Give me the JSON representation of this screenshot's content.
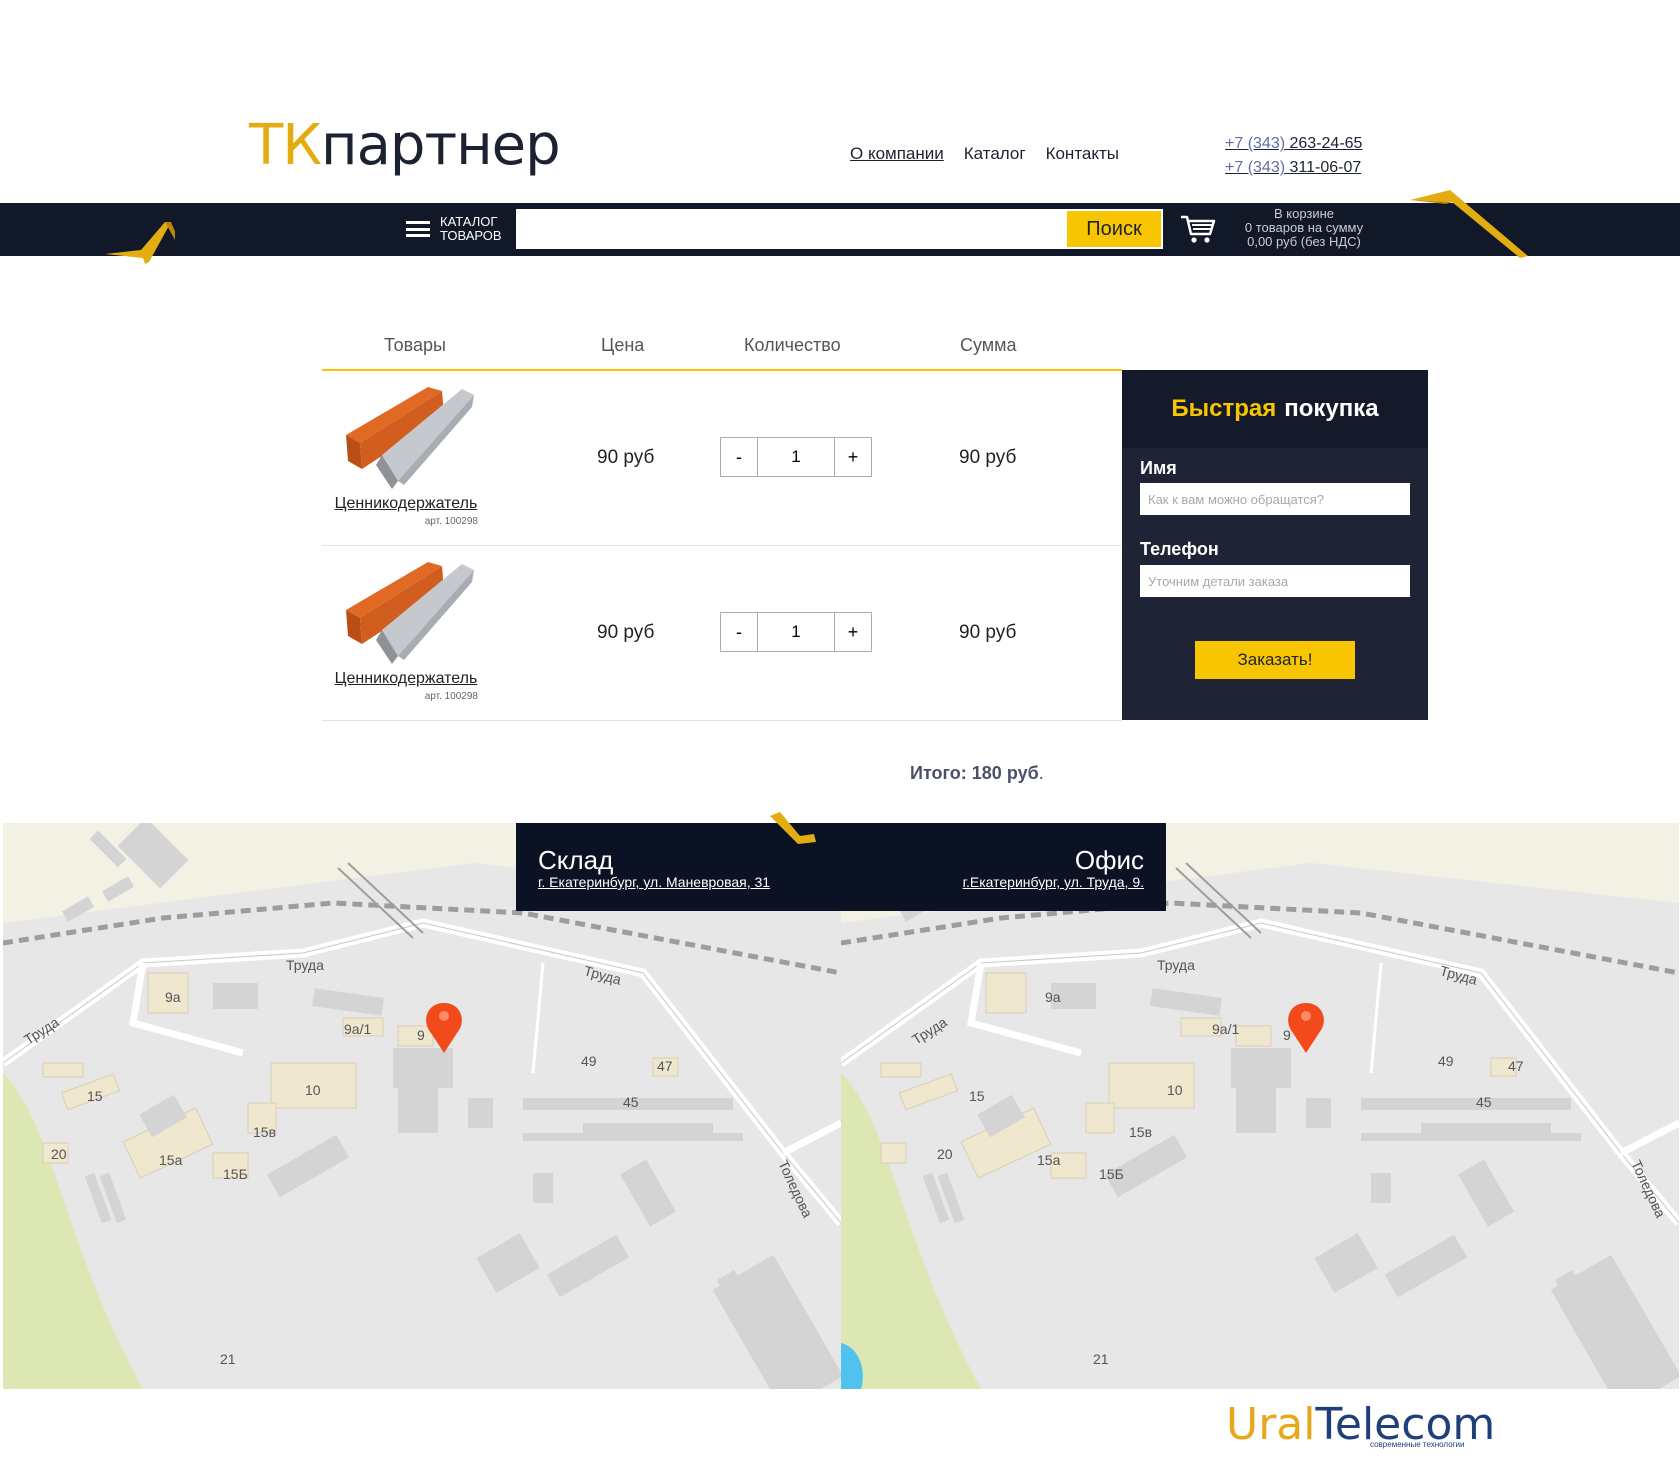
{
  "brand": {
    "logo_tk": "ТК",
    "logo_rest": "партнер"
  },
  "nav": [
    {
      "label": "О компании"
    },
    {
      "label": "Каталог"
    },
    {
      "label": "Контакты"
    }
  ],
  "phones": [
    {
      "code": "+7 (343)",
      "number": "263-24-65"
    },
    {
      "code": "+7 (343)",
      "number": "311-06-07"
    }
  ],
  "catalog_button": {
    "line1": "КАТАЛОГ",
    "line2": "ТОВАРОВ"
  },
  "search": {
    "value": "",
    "button_label": "Поиск"
  },
  "cart_summary": {
    "line1": "В корзине",
    "line2": "0 товаров на сумму",
    "line3": "0,00 руб (без НДС)"
  },
  "table": {
    "headers": {
      "products": "Товары",
      "price": "Цена",
      "quantity": "Количество",
      "sum": "Сумма"
    },
    "rows": [
      {
        "name": "Ценникодержатель",
        "article": "арт. 100298",
        "price": "90 руб",
        "qty": "1",
        "sum": "90 руб"
      },
      {
        "name": "Ценникодержатель",
        "article": "арт. 100298",
        "price": "90 руб",
        "qty": "1",
        "sum": "90 руб"
      }
    ],
    "minus_label": "-",
    "plus_label": "+"
  },
  "quick_buy": {
    "title_accent": "Быстрая",
    "title_rest": "покупка",
    "name_label": "Имя",
    "name_placeholder": "Как к вам можно обращатся?",
    "phone_label": "Телефон",
    "phone_placeholder": "Уточним детали заказа",
    "submit_label": "Заказать!"
  },
  "total": {
    "label": "Итого:",
    "value": "180 руб",
    "suffix": "."
  },
  "locations": [
    {
      "title": "Склад",
      "address": "г. Екатеринбург, ул. Маневровая, 31"
    },
    {
      "title": "Офис",
      "address": "г.Екатеринбург, ул. Труда, 9."
    }
  ],
  "map_labels": {
    "streets": [
      "Труда",
      "Труда",
      "Труда",
      "Толедова"
    ],
    "houses": [
      "9а",
      "9а/1",
      "9",
      "10",
      "15",
      "15в",
      "15а",
      "15Б",
      "20",
      "21",
      "45",
      "47",
      "49"
    ]
  },
  "footer": {
    "brand_u": "Ural",
    "brand_t": "Telecom",
    "tagline": "современные технологии"
  },
  "colors": {
    "accent": "#f7c600",
    "dark": "#111827",
    "panel": "#1e2436",
    "text": "#1d2233"
  }
}
